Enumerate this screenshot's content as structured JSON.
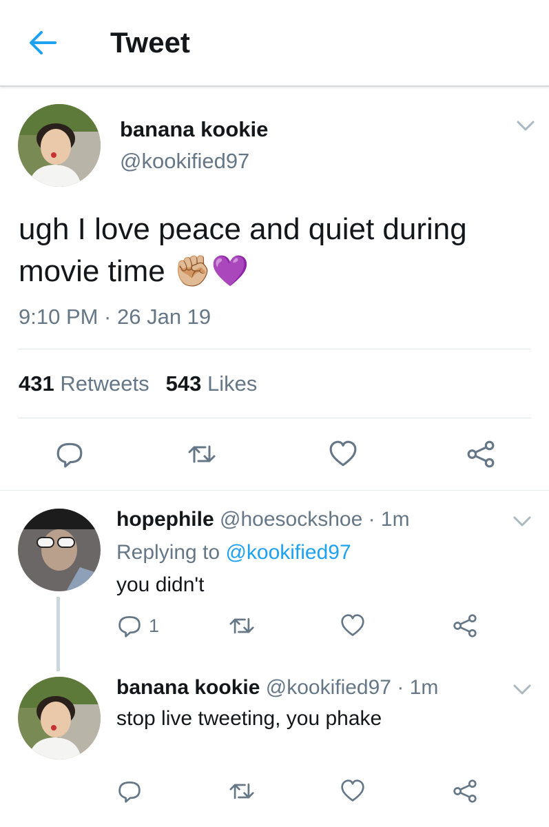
{
  "header": {
    "title": "Tweet"
  },
  "main_tweet": {
    "name": "banana kookie",
    "handle": "@kookified97",
    "text": "ugh I love peace and quiet during movie time",
    "emoji": "✊🏼💜",
    "time": "9:10 PM · 26 Jan 19",
    "retweets_count": "431",
    "retweets_label": "Retweets",
    "likes_count": "543",
    "likes_label": "Likes"
  },
  "replies": [
    {
      "name": "hopephile",
      "handle": "@hoesockshoe",
      "time": "· 1m",
      "replying_prefix": "Replying to",
      "replying_to": "@kookified97",
      "text": "you didn't",
      "reply_count": "1"
    },
    {
      "name": "banana kookie",
      "handle": "@kookified97",
      "time": "· 1m",
      "text": "stop live tweeting, you phake"
    }
  ],
  "icons": {
    "back": "arrow-left-icon",
    "reply": "reply-icon",
    "retweet": "retweet-icon",
    "like": "heart-icon",
    "share": "share-icon",
    "caret": "chevron-down-icon"
  },
  "colors": {
    "accent": "#1da1f2",
    "secondary_text": "#657786",
    "icon": "#657786"
  }
}
